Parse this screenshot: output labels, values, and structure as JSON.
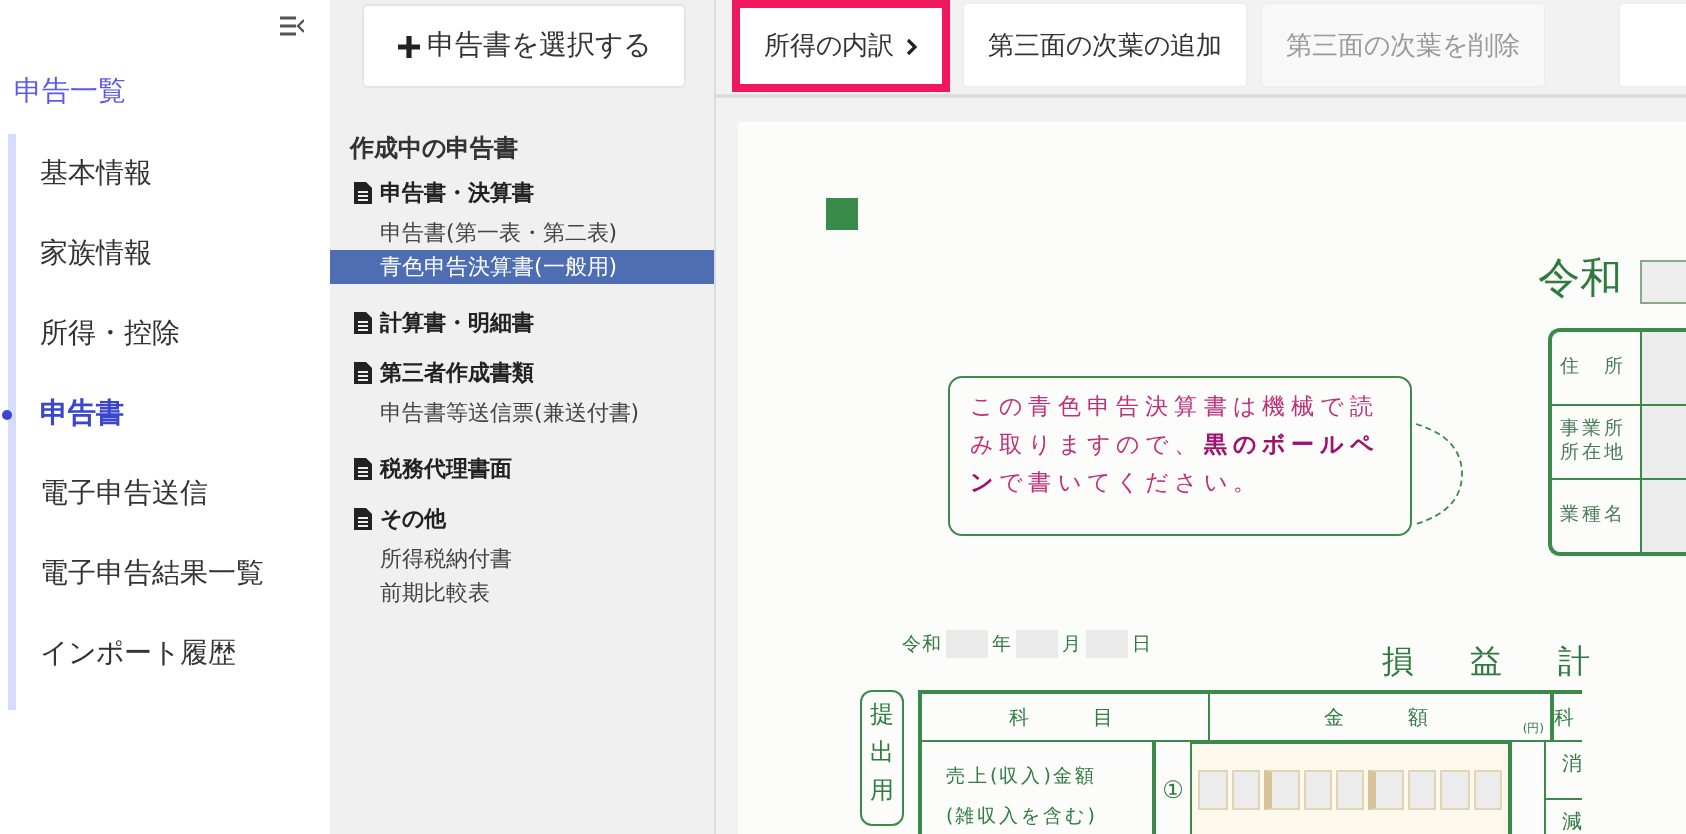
{
  "sidebar": {
    "top_link": "申告一覧",
    "items": [
      {
        "label": "基本情報",
        "selected": false
      },
      {
        "label": "家族情報",
        "selected": false
      },
      {
        "label": "所得・控除",
        "selected": false
      },
      {
        "label": "申告書",
        "selected": true
      },
      {
        "label": "電子申告送信",
        "selected": false
      },
      {
        "label": "電子申告結果一覧",
        "selected": false
      },
      {
        "label": "インポート履歴",
        "selected": false
      }
    ]
  },
  "panel": {
    "add_button": "申告書を選択する",
    "heading": "作成中の申告書",
    "groups": [
      {
        "title": "申告書・決算書",
        "items": [
          {
            "label": "申告書(第一表・第二表)",
            "selected": false
          },
          {
            "label": "青色申告決算書(一般用)",
            "selected": true
          }
        ]
      },
      {
        "title": "計算書・明細書"
      },
      {
        "title": "第三者作成書類",
        "items": [
          {
            "label": "申告書等送信票(兼送付書)",
            "selected": false
          }
        ]
      },
      {
        "title": "税務代理書面"
      },
      {
        "title": "その他",
        "items": [
          {
            "label": "所得税納付書",
            "selected": false
          },
          {
            "label": "前期比較表",
            "selected": false
          }
        ]
      }
    ]
  },
  "toolbar": {
    "buttons": [
      {
        "label": "所得の内訳",
        "kind": "next",
        "highlighted": true,
        "disabled": false
      },
      {
        "label": "第三面の次葉の追加",
        "kind": "plain",
        "highlighted": false,
        "disabled": false
      },
      {
        "label": "第三面の次葉を削除",
        "kind": "plain",
        "highlighted": false,
        "disabled": true
      }
    ]
  },
  "document": {
    "era": "令和",
    "address_labels": [
      "住　所",
      "事業所所在地",
      "業種名"
    ],
    "notice": "この青色申告決算書は機械で読み取りますので、**黒のボールペン**で書いてください。",
    "date": {
      "era": "令和",
      "year": "年",
      "month": "月",
      "day": "日"
    },
    "title": "損　益　計",
    "stamp": "提出用",
    "table": {
      "columns": [
        "科　　目",
        "金　　額",
        "科"
      ],
      "unit": "(円)",
      "rows": [
        {
          "label": "売上(収入)金額\n(雑収入を含む)",
          "number": "①"
        }
      ],
      "right_rows": [
        "消",
        "減"
      ]
    }
  }
}
